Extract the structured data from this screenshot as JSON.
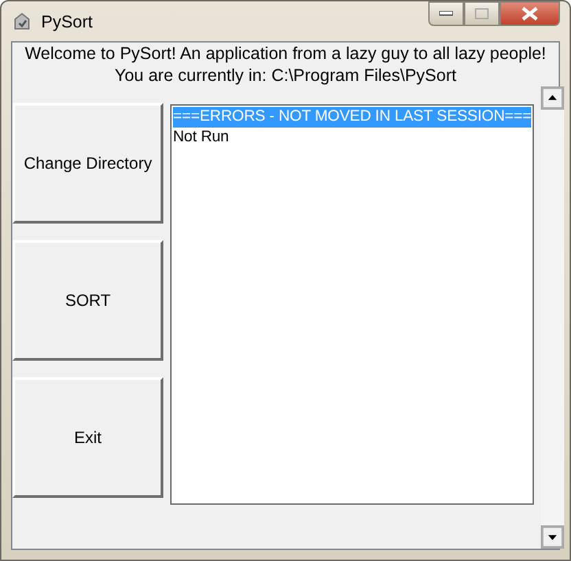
{
  "window": {
    "title": "PySort"
  },
  "header": {
    "lines": [
      "Welcome to PySort! An application from a lazy guy to all lazy people!",
      "You are currently in: C:\\Program Files\\PySort"
    ]
  },
  "buttons": [
    "Change Directory",
    "SORT",
    "Exit"
  ],
  "list": {
    "items": [
      {
        "text": "===ERRORS - NOT MOVED IN LAST SESSION===",
        "selected": true
      },
      {
        "text": "Not Run",
        "selected": false
      }
    ]
  }
}
